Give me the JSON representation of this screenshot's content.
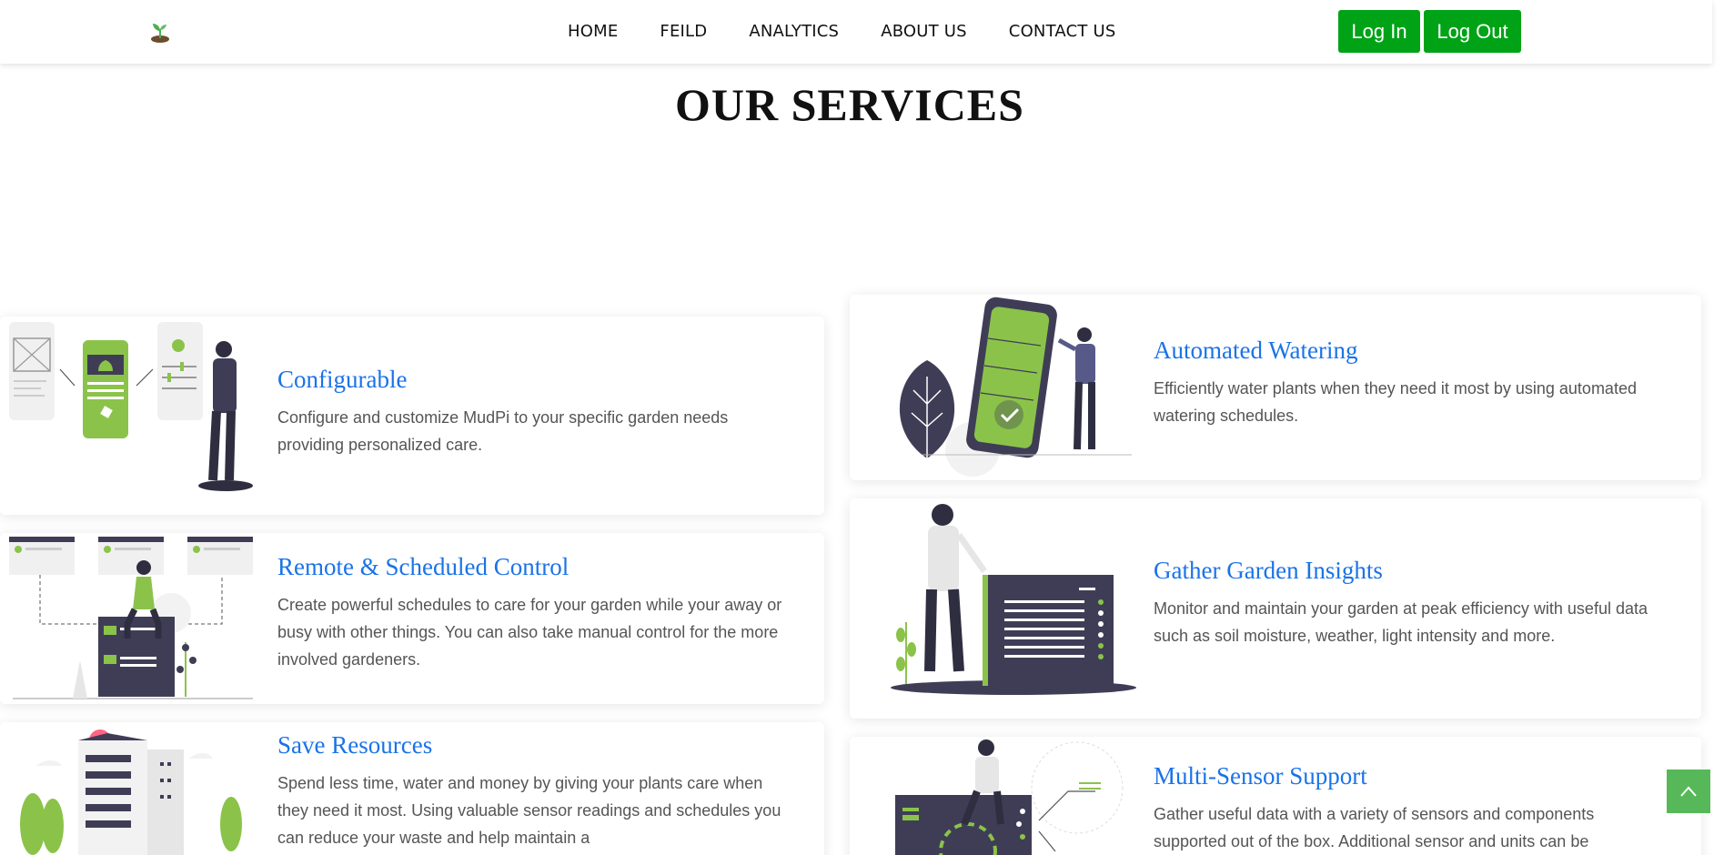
{
  "nav": {
    "items": [
      "HOME",
      "FEILD",
      "ANALYTICS",
      "ABOUT US",
      "CONTACT US"
    ],
    "login_label": "Log In",
    "logout_label": "Log Out"
  },
  "section": {
    "title": "OUR SERVICES"
  },
  "services": [
    {
      "title": "Configurable",
      "desc": "Configure and customize MudPi to your specific garden needs providing personalized care."
    },
    {
      "title": "Automated Watering",
      "desc": "Efficiently water plants when they need it most by using automated watering schedules."
    },
    {
      "title": "Remote & Scheduled Control",
      "desc": "Create powerful schedules to care for your garden while your away or busy with other things. You can also take manual control for the more involved gardeners."
    },
    {
      "title": "Gather Garden Insights",
      "desc": "Monitor and maintain your garden at peak efficiency with useful data such as soil moisture, weather, light intensity and more."
    },
    {
      "title": "Save Resources",
      "desc": "Spend less time, water and money by giving your plants care when they need it most. Using valuable sensor readings and schedules you can reduce your waste and help maintain a"
    },
    {
      "title": "Multi-Sensor Support",
      "desc": "Gather useful data with a variety of sensors and components supported out of the box. Additional sensor and units can be"
    }
  ],
  "colors": {
    "accent_green": "#00a316",
    "title_blue": "#1a73e8",
    "illustration_green": "#8bc34a",
    "illustration_dark": "#3f3d56"
  },
  "icons": [
    "seedling-logo-icon",
    "chevron-up-icon"
  ]
}
